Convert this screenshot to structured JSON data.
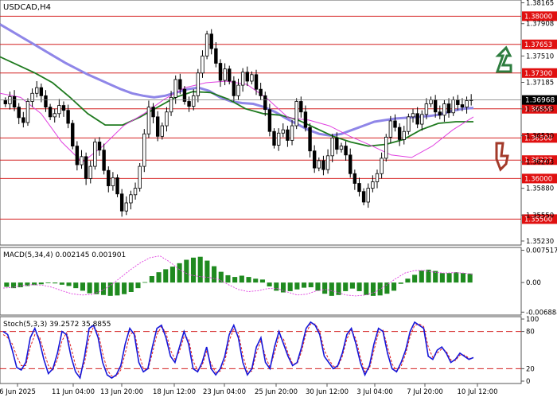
{
  "chart_data": [
    {
      "type": "candlestick",
      "title": "USDCAD,H4",
      "x_ticks": [
        "6 Jun 2025",
        "11 Jun 04:00",
        "13 Jun 20:00",
        "18 Jun 12:00",
        "23 Jun 04:00",
        "25 Jun 20:00",
        "30 Jun 12:00",
        "3 Jul 04:00",
        "7 Jul 20:00",
        "10 Jul 12:00"
      ],
      "y_ticks": [
        "1.38165",
        "1.37908",
        "1.37510",
        "1.37185",
        "1.36858",
        "1.36530",
        "1.36203",
        "1.35880",
        "1.35550",
        "1.35230"
      ],
      "ylim": [
        1.352,
        1.3818
      ],
      "current_price": "1.36968",
      "levels": [
        {
          "label": "1.38000",
          "value": 1.38
        },
        {
          "label": "1.37653",
          "value": 1.37653
        },
        {
          "label": "1.37300",
          "value": 1.373
        },
        {
          "label": "1.36859",
          "value": 1.36859
        },
        {
          "label": "1.36500",
          "value": 1.365
        },
        {
          "label": "1.36227",
          "value": 1.36227
        },
        {
          "label": "1.36000",
          "value": 1.36
        },
        {
          "label": "1.35500",
          "value": 1.355
        }
      ],
      "candle_closes": [
        1.3692,
        1.3701,
        1.3688,
        1.3675,
        1.3669,
        1.3695,
        1.3705,
        1.3712,
        1.3702,
        1.3688,
        1.3676,
        1.368,
        1.369,
        1.3684,
        1.3668,
        1.364,
        1.3617,
        1.3627,
        1.36,
        1.3615,
        1.3645,
        1.3635,
        1.361,
        1.3591,
        1.3601,
        1.3581,
        1.356,
        1.357,
        1.358,
        1.3588,
        1.3615,
        1.3655,
        1.3688,
        1.3676,
        1.3652,
        1.3665,
        1.3682,
        1.37,
        1.3722,
        1.371,
        1.3695,
        1.3689,
        1.3702,
        1.373,
        1.3751,
        1.3778,
        1.376,
        1.3742,
        1.3721,
        1.3735,
        1.372,
        1.3702,
        1.3715,
        1.3731,
        1.372,
        1.3728,
        1.371,
        1.3702,
        1.3685,
        1.3658,
        1.3641,
        1.3656,
        1.366,
        1.3647,
        1.3665,
        1.3695,
        1.3682,
        1.3663,
        1.3634,
        1.3613,
        1.3622,
        1.3611,
        1.3628,
        1.365,
        1.3636,
        1.364,
        1.3629,
        1.3606,
        1.3594,
        1.3584,
        1.3571,
        1.3588,
        1.3596,
        1.3606,
        1.3625,
        1.3651,
        1.3671,
        1.3663,
        1.3648,
        1.3658,
        1.3676,
        1.368,
        1.3667,
        1.3679,
        1.3692,
        1.3697,
        1.3682,
        1.3678,
        1.3692,
        1.3681,
        1.3697,
        1.3691,
        1.3688,
        1.3696,
        1.3697
      ],
      "series": [
        {
          "name": "",
          "color": "#8f86e8",
          "values": [
            1.379,
            1.3782,
            1.3774,
            1.3766,
            1.3758,
            1.375,
            1.3742,
            1.3735,
            1.3728,
            1.3722,
            1.3716,
            1.371,
            1.3705,
            1.3702,
            1.37,
            1.3702,
            1.3706,
            1.371,
            1.3712,
            1.3708,
            1.37,
            1.3695,
            1.3693,
            1.3692,
            1.3688,
            1.3682,
            1.3674,
            1.3667,
            1.366,
            1.3655,
            1.3653,
            1.3655,
            1.366,
            1.3665,
            1.367,
            1.3672,
            1.3674,
            1.3675,
            1.3676,
            1.3677,
            1.3679,
            1.3683,
            1.3686,
            1.3687
          ]
        },
        {
          "name": "",
          "color": "#1f7a1f",
          "values": [
            1.375,
            1.374,
            1.373,
            1.3718,
            1.37,
            1.368,
            1.3666,
            1.3666,
            1.3676,
            1.3688,
            1.37,
            1.3707,
            1.3706,
            1.3698,
            1.3686,
            1.368,
            1.3678,
            1.3672,
            1.3662,
            1.3652,
            1.3645,
            1.364,
            1.3642,
            1.3648,
            1.366,
            1.3668,
            1.367,
            1.367
          ]
        },
        {
          "name": "",
          "color": "#e040e0",
          "values": [
            1.3705,
            1.37,
            1.368,
            1.3645,
            1.362,
            1.364,
            1.3665,
            1.368,
            1.3698,
            1.3712,
            1.3718,
            1.372,
            1.3716,
            1.3698,
            1.3675,
            1.3672,
            1.3665,
            1.3652,
            1.3641,
            1.3629,
            1.3626,
            1.364,
            1.366,
            1.3676
          ]
        }
      ]
    },
    {
      "type": "bar",
      "title": "MACD(5,34,4) 0.002145 0.001901",
      "y_ticks": [
        "0.007517",
        "0.00",
        "-0.006884"
      ],
      "ylim": [
        -0.0072,
        0.0078
      ],
      "values": [
        -0.001,
        -0.0013,
        -0.0011,
        -0.0008,
        -0.0006,
        -0.0004,
        -0.0001,
        -0.0002,
        -0.0005,
        -0.0008,
        -0.0013,
        -0.0019,
        -0.0025,
        -0.0027,
        -0.0029,
        -0.0031,
        -0.003,
        -0.0027,
        -0.0022,
        -0.0013,
        0.0001,
        0.0015,
        0.0024,
        0.0031,
        0.0037,
        0.0045,
        0.0053,
        0.0058,
        0.006,
        0.0051,
        0.0038,
        0.0025,
        0.0017,
        0.0013,
        0.0016,
        0.0013,
        0.0009,
        0.0007,
        -0.0009,
        -0.0019,
        -0.0023,
        -0.002,
        -0.0016,
        -0.0012,
        -0.0011,
        -0.0019,
        -0.0026,
        -0.0031,
        -0.0029,
        -0.002,
        -0.0014,
        -0.002,
        -0.0029,
        -0.0031,
        -0.003,
        -0.0026,
        -0.0019,
        -0.0003,
        0.0009,
        0.0018,
        0.0028,
        0.003,
        0.0027,
        0.0022,
        0.0022,
        0.0024,
        0.0022,
        0.0021
      ],
      "signal_line": [
        -0.0013,
        -0.0011,
        -0.0007,
        -0.0005,
        -0.0006,
        -0.0011,
        -0.0019,
        -0.0026,
        -0.0029,
        -0.0028,
        -0.002,
        -0.0006,
        0.0012,
        0.003,
        0.0046,
        0.0058,
        0.0062,
        0.0048,
        0.003,
        0.0018,
        0.0014,
        0.0012,
        0.0007,
        -0.0005,
        -0.0016,
        -0.0021,
        -0.0019,
        -0.0014,
        -0.0014,
        -0.0022,
        -0.0029,
        -0.0027,
        -0.0019,
        -0.0016,
        -0.0022,
        -0.0029,
        -0.0031,
        -0.0029,
        -0.0022,
        -0.0008,
        0.0008,
        0.0022,
        0.0028,
        0.0028,
        0.0024,
        0.0022,
        0.0023,
        0.0022,
        0.0019
      ]
    },
    {
      "type": "line",
      "title": "Stoch(5,3,3) 39.2572 35.8855",
      "y_ticks": [
        "100",
        "80",
        "20",
        "0"
      ],
      "ylim": [
        0,
        100
      ],
      "levels": [
        80,
        20
      ],
      "series": [
        {
          "name": "",
          "color": "#1616d8",
          "values": [
            80,
            75,
            50,
            22,
            18,
            30,
            70,
            85,
            65,
            35,
            12,
            20,
            45,
            80,
            75,
            40,
            15,
            5,
            40,
            85,
            90,
            70,
            30,
            10,
            5,
            10,
            25,
            60,
            85,
            75,
            30,
            15,
            20,
            55,
            85,
            90,
            70,
            40,
            30,
            55,
            80,
            60,
            20,
            15,
            30,
            55,
            20,
            10,
            20,
            40,
            75,
            90,
            70,
            30,
            10,
            20,
            55,
            70,
            30,
            20,
            55,
            80,
            60,
            40,
            25,
            30,
            55,
            85,
            95,
            90,
            75,
            40,
            30,
            20,
            25,
            45,
            75,
            85,
            60,
            30,
            10,
            25,
            60,
            85,
            80,
            45,
            20,
            15,
            30,
            50,
            80,
            95,
            90,
            85,
            40,
            35,
            50,
            55,
            45,
            30,
            35,
            45,
            40,
            35,
            38
          ]
        },
        {
          "name": "",
          "color": "#e02020",
          "values": [
            75,
            70,
            60,
            40,
            25,
            25,
            55,
            75,
            72,
            48,
            25,
            18,
            35,
            65,
            78,
            55,
            25,
            10,
            30,
            70,
            88,
            78,
            45,
            18,
            8,
            8,
            18,
            45,
            75,
            80,
            45,
            20,
            18,
            45,
            75,
            88,
            78,
            50,
            35,
            48,
            72,
            68,
            32,
            18,
            25,
            48,
            28,
            14,
            16,
            32,
            65,
            85,
            78,
            42,
            15,
            16,
            45,
            65,
            40,
            22,
            45,
            72,
            68,
            45,
            28,
            28,
            48,
            78,
            92,
            92,
            80,
            50,
            35,
            24,
            23,
            40,
            68,
            82,
            68,
            38,
            15,
            20,
            50,
            78,
            82,
            55,
            28,
            16,
            24,
            44,
            72,
            90,
            92,
            88,
            55,
            38,
            45,
            52,
            48,
            34,
            33,
            42,
            42,
            37,
            36
          ]
        }
      ]
    }
  ],
  "arrows": {
    "up_color": "#2e7d3f",
    "down_color": "#a33a2a"
  }
}
